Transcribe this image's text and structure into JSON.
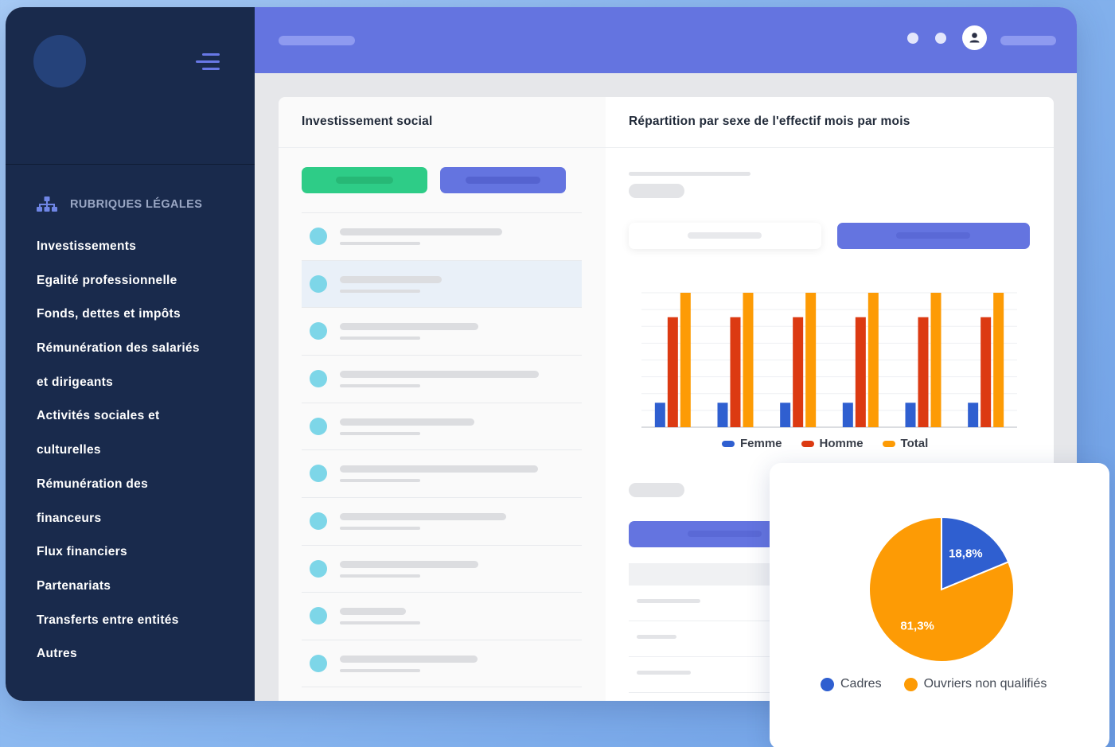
{
  "sidebar": {
    "section_title": "RUBRIQUES LÉGALES",
    "items": [
      {
        "label": "Investissements"
      },
      {
        "label": "Egalité professionnelle"
      },
      {
        "label": "Fonds, dettes et impôts"
      },
      {
        "label": "Rémunération des salariés"
      },
      {
        "label": "et dirigeants"
      },
      {
        "label": "Activités sociales et"
      },
      {
        "label": "culturelles"
      },
      {
        "label": "Rémunération des"
      },
      {
        "label": "financeurs"
      },
      {
        "label": "Flux financiers"
      },
      {
        "label": "Partenariats"
      },
      {
        "label": "Transferts entre entités"
      },
      {
        "label": "Autres"
      }
    ]
  },
  "header": {
    "icons": [
      "menu-icon",
      "user-icon",
      "org-chart-icon"
    ]
  },
  "left_card": {
    "title": "Investissement social"
  },
  "right_card": {
    "title": "Répartition par sexe de l'effectif mois par mois"
  },
  "colors": {
    "sidebar": "#192a4c",
    "topbar": "#6474e0",
    "accent": "#6474e0",
    "green": "#2ecc87",
    "femme": "#2f5fd0",
    "homme": "#dc3a12",
    "total": "#fd9b05"
  },
  "chart_data": [
    {
      "type": "bar",
      "categories": [
        "",
        "",
        "",
        "",
        "",
        ""
      ],
      "series": [
        {
          "name": "Femme",
          "color": "#2f5fd0",
          "values": [
            1,
            1,
            1,
            1,
            1,
            1
          ]
        },
        {
          "name": "Homme",
          "color": "#dc3a12",
          "values": [
            4.5,
            4.5,
            4.5,
            4.5,
            4.5,
            4.5
          ]
        },
        {
          "name": "Total",
          "color": "#fd9b05",
          "values": [
            5.5,
            5.5,
            5.5,
            5.5,
            5.5,
            5.5
          ]
        }
      ],
      "ylim": [
        0,
        5.5
      ],
      "grid": true,
      "legend": "bottom"
    },
    {
      "type": "pie",
      "slices": [
        {
          "name": "Cadres",
          "value": 18.8,
          "label": "18,8%",
          "color": "#2f5fd0"
        },
        {
          "name": "Ouvriers non qualifiés",
          "value": 81.3,
          "label": "81,3%",
          "color": "#fd9b05"
        }
      ],
      "legend": "bottom"
    }
  ]
}
